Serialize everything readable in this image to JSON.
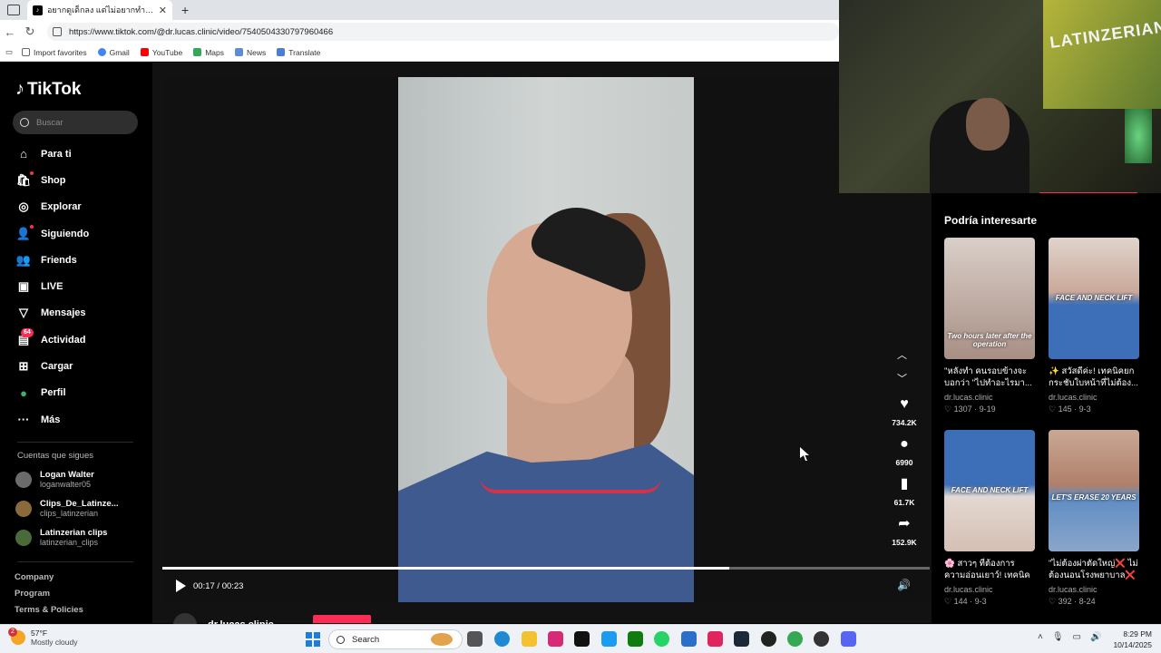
{
  "browser": {
    "tab_title": "อยากดูเด็กลง แต่ไม่อยากทำศัลยกรรมใ...",
    "url": "https://www.tiktok.com/@dr.lucas.clinic/video/7540504330797960466",
    "bookmarks": [
      "Import favorites",
      "Gmail",
      "YouTube",
      "Maps",
      "News",
      "Translate"
    ]
  },
  "tiktok": {
    "brand": "TikTok",
    "search_placeholder": "Buscar",
    "nav": [
      {
        "label": "Para ti",
        "icon": "home-icon"
      },
      {
        "label": "Shop",
        "icon": "shop-icon"
      },
      {
        "label": "Explorar",
        "icon": "compass-icon"
      },
      {
        "label": "Siguiendo",
        "icon": "following-icon"
      },
      {
        "label": "Friends",
        "icon": "friends-icon"
      },
      {
        "label": "LIVE",
        "icon": "live-icon"
      },
      {
        "label": "Mensajes",
        "icon": "messages-icon"
      },
      {
        "label": "Actividad",
        "icon": "activity-icon",
        "badge": "64"
      },
      {
        "label": "Cargar",
        "icon": "upload-icon"
      },
      {
        "label": "Perfil",
        "icon": "profile-icon"
      },
      {
        "label": "Más",
        "icon": "more-icon"
      }
    ],
    "following_title": "Cuentas que sigues",
    "following": [
      {
        "name": "Logan Walter",
        "handle": "loganwalter05"
      },
      {
        "name": "Clips_De_Latinze...",
        "handle": "clips_latinzerian"
      },
      {
        "name": "Latinzerian clips",
        "handle": "latinzerian_clips"
      }
    ],
    "footer": [
      "Company",
      "Program",
      "Terms & Policies"
    ]
  },
  "player": {
    "time": "00:17 / 00:23",
    "progress": 0.7391,
    "author": "dr.lucas.clinic",
    "likes": "734.2K",
    "comments": "6990",
    "saves": "61.7K",
    "shares": "152.9K"
  },
  "recommendations": {
    "title": "Podría interesarte",
    "cards": [
      {
        "desc": "\"หลังทำ คนรอบข้างจะบอกว่า \"ไปทำอะไรมา...",
        "user": "dr.lucas.clinic",
        "likes": "1307",
        "date": "9-19",
        "caption": "Two hours later after the operation",
        "color": "#c9b7ad"
      },
      {
        "desc": "✨ สวัสดีค่ะ! เทคนิคยกกระชับใบหน้าที่ไม่ต้อง...",
        "user": "dr.lucas.clinic",
        "likes": "145",
        "date": "9-3",
        "caption": "FACE AND NECK LIFT",
        "color": "#3d6fb8"
      },
      {
        "desc": "🌸 สาวๆ ที่ต้องการความอ่อนเยาว์! เทคนิคยก...",
        "user": "dr.lucas.clinic",
        "likes": "144",
        "date": "9-3",
        "caption": "FACE AND NECK LIFT",
        "color": "#3d6fb8"
      },
      {
        "desc": "\"ไม่ต้องผ่าตัดใหญ่❌ ไม่ต้องนอนโรงพยาบาล❌ แค่...",
        "user": "dr.lucas.clinic",
        "likes": "392",
        "date": "8-24",
        "caption": "LET'S ERASE 20 YEARS",
        "color": "#5f8cc4"
      }
    ]
  },
  "webcam": {
    "poster_text": "LATINZERIAN"
  },
  "taskbar": {
    "temp": "57°F",
    "weather": "Mostly cloudy",
    "weather_badge": "2",
    "search": "Search",
    "time": "8:29 PM",
    "date": "10/14/2025"
  }
}
